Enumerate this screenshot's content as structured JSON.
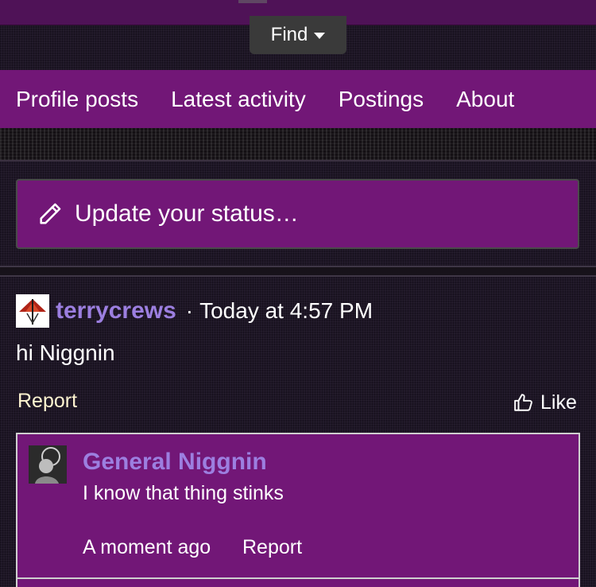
{
  "header": {
    "find_label": "Find"
  },
  "tabs": [
    {
      "label": "Profile posts"
    },
    {
      "label": "Latest activity"
    },
    {
      "label": "Postings"
    },
    {
      "label": "About"
    }
  ],
  "status": {
    "placeholder": "Update your status…"
  },
  "post": {
    "author": "terrycrews",
    "separator": "·",
    "time": "Today at 4:57 PM",
    "body": "hi Niggnin",
    "report_label": "Report",
    "like_label": "Like"
  },
  "comment": {
    "author": "General Niggnin",
    "text": "I know that thing stinks",
    "time": "A moment ago",
    "report_label": "Report"
  },
  "colors": {
    "accent_purple": "#721777",
    "username": "#9c7fe0",
    "report_link": "#fff5d0"
  },
  "icons": {
    "find_caret": "caret-down-icon",
    "status": "pencil-icon",
    "like": "thumbs-up-icon"
  }
}
